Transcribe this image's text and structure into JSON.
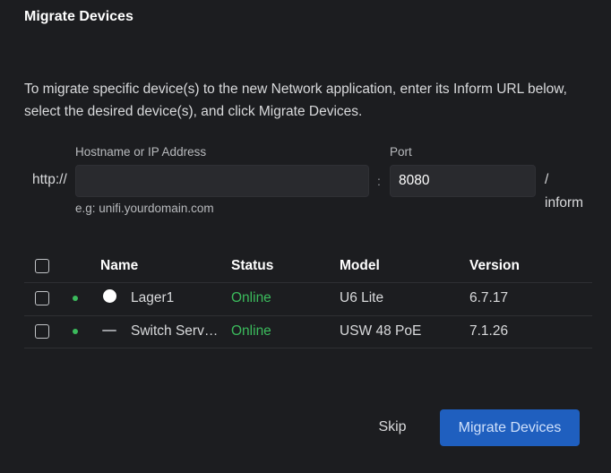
{
  "dialog": {
    "title": "Migrate Devices",
    "description": "To migrate specific device(s) to the new Network application, enter its Inform URL below, select the desired device(s), and click Migrate Devices."
  },
  "inform_url": {
    "prefix": "http://",
    "hostname_label": "Hostname or IP Address",
    "hostname_value": "",
    "hostname_hint": "e.g: unifi.yourdomain.com",
    "separator": ":",
    "port_label": "Port",
    "port_value": "8080",
    "suffix_slash": "/",
    "suffix_path": "inform"
  },
  "table": {
    "headers": {
      "name": "Name",
      "status": "Status",
      "model": "Model",
      "version": "Version"
    },
    "rows": [
      {
        "name": "Lager1",
        "status": "Online",
        "model": "U6 Lite",
        "version": "6.7.17",
        "icon": "access-point-icon"
      },
      {
        "name": "Switch Serv…",
        "status": "Online",
        "model": "USW 48 PoE",
        "version": "7.1.26",
        "icon": "switch-icon"
      }
    ],
    "status_color": "#3bba5c"
  },
  "actions": {
    "skip_label": "Skip",
    "migrate_label": "Migrate Devices",
    "primary_color": "#1f5fbf"
  }
}
